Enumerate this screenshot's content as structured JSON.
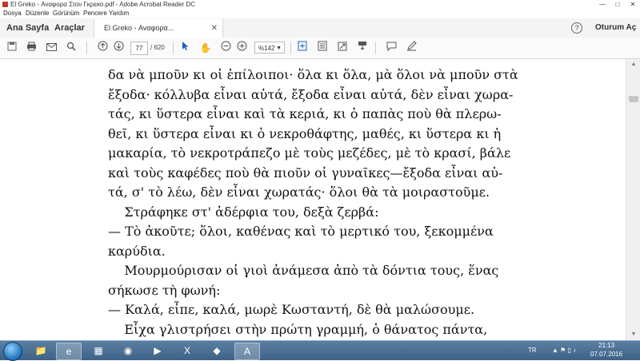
{
  "window": {
    "title": "El Greko - Αναφορα Στον Γκρεκο.pdf - Adobe Acrobat Reader DC",
    "controls": [
      "—",
      "□",
      "✕"
    ]
  },
  "menu": [
    "Dosya",
    "Düzenle",
    "Görünüm",
    "Pencere",
    "Yardım"
  ],
  "nav": {
    "home": "Ana Sayfa",
    "tools": "Araçlar",
    "doc_tab": "El Greko - Αναφορα...",
    "help": "?",
    "sign_in": "Oturum Aç"
  },
  "toolbar": {
    "current_page": "77",
    "total_pages": "/ 620",
    "zoom": "%142",
    "icons": [
      "save-icon",
      "print-icon",
      "email-icon",
      "search-icon",
      "prev-page-icon",
      "next-page-icon",
      "select-cursor-icon",
      "hand-tool-icon",
      "zoom-out-icon",
      "zoom-in-icon",
      "fit-page-icon",
      "full-screen-icon",
      "rotate-icon",
      "comment-icon",
      "sign-icon"
    ]
  },
  "document": {
    "lines": [
      "δα νὰ μποῦν κι οἱ ἐπίλοιποι· ὅλα κι ὅλα, μὰ ὅλοι νὰ μποῦν στὰ",
      "ἔξοδα· κόλλυβα εἶναι αὐτά, ἔξοδα εἶναι αὐτά, δὲν εἶναι χωρα-",
      "τάς, κι ὕστερα εἶναι καὶ τὰ κεριά, κι ὁ παπὰς ποὺ θὰ πλερω-",
      "θεῖ, κι ὕστερα εἶναι κι ὁ νεκροθάφτης, μαθές, κι ὕστερα κι ἡ",
      "μακαρία, τὸ νεκροτράπεζο μὲ τοὺς μεζέδες, μὲ τὸ κρασί, βάλε",
      "καὶ τοὺς καφέδες ποὺ θὰ πιοῦν οἱ γυναῖκες—ἔξοδα εἶναι αὐ-",
      "τά, σ' τὸ λέω, δὲν εἶναι χωρατάς· ὅλοι θὰ τὰ μοιραστοῦμε.",
      "    Στράφηκε στ' ἀδέρφια του, δεξὰ ζερβά:",
      "— Τὸ ἀκοῦτε; ὅλοι, καθένας καὶ τὸ μερτικό του, ξεκομμένα",
      "καρύδια.",
      "    Μουρμούρισαν οἱ γιοὶ ἀνάμεσα ἀπὸ τὰ δόντια τους, ἕνας",
      "σήκωσε τὴ φωνή:",
      "— Καλά, εἶπε, καλά, μωρὲ Κωσταντή, δὲ θὰ μαλώσουμε.",
      "    Εἶχα γλιστρήσει στὴν πρώτη γραμμή, ὁ θάνατος πάντα,"
    ]
  },
  "taskbar": {
    "language": "TR",
    "time": "21:13",
    "date": "07.07.2016"
  }
}
